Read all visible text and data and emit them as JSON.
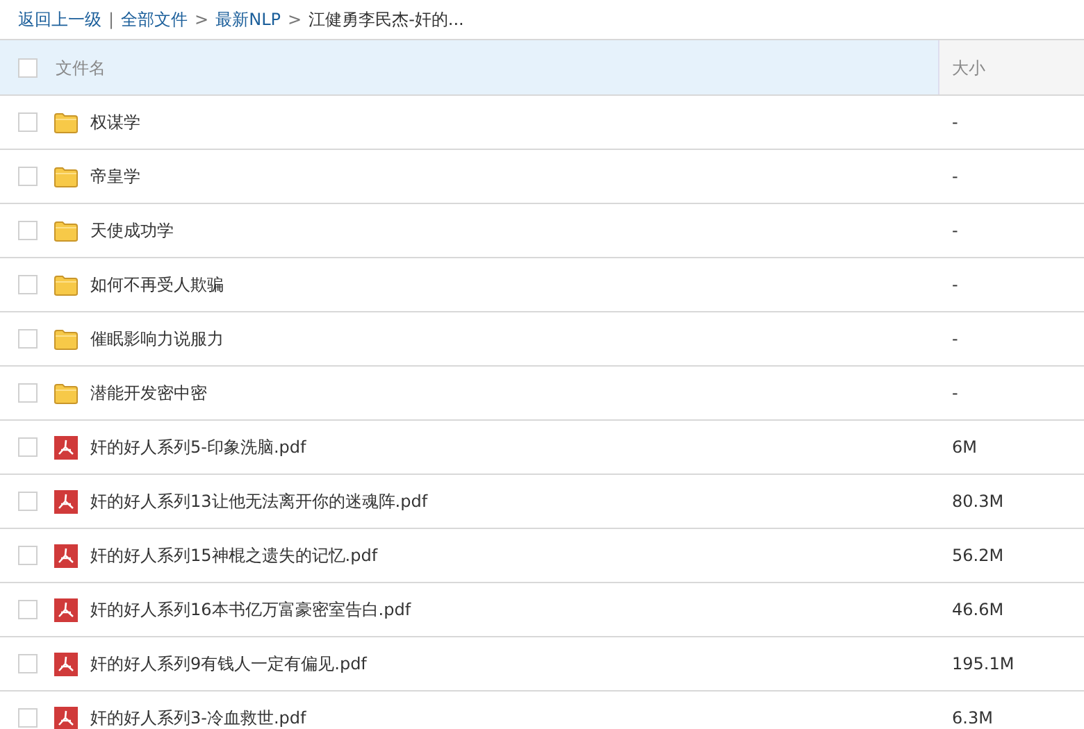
{
  "breadcrumb": {
    "back": "返回上一级",
    "separator": "|",
    "links": [
      "全部文件",
      "最新NLP"
    ],
    "arrow": ">",
    "current": "江健勇李民杰-奸的..."
  },
  "table": {
    "select_all": {
      "checked": false
    },
    "columns": [
      "文件名",
      "大小"
    ],
    "rows": [
      {
        "kind": "folder",
        "name": "权谋学",
        "size": "-",
        "checked": false
      },
      {
        "kind": "folder",
        "name": "帝皇学",
        "size": "-",
        "checked": false
      },
      {
        "kind": "folder",
        "name": "天使成功学",
        "size": "-",
        "checked": false
      },
      {
        "kind": "folder",
        "name": "如何不再受人欺骗",
        "size": "-",
        "checked": false
      },
      {
        "kind": "folder",
        "name": "催眠影响力说服力",
        "size": "-",
        "checked": false
      },
      {
        "kind": "folder",
        "name": "潜能开发密中密",
        "size": "-",
        "checked": false
      },
      {
        "kind": "pdf",
        "name": "奸的好人系列5-印象洗脑.pdf",
        "size": "6M",
        "checked": false
      },
      {
        "kind": "pdf",
        "name": "奸的好人系列13让他无法离开你的迷魂阵.pdf",
        "size": "80.3M",
        "checked": false
      },
      {
        "kind": "pdf",
        "name": "奸的好人系列15神棍之遗失的记忆.pdf",
        "size": "56.2M",
        "checked": false
      },
      {
        "kind": "pdf",
        "name": "奸的好人系列16本书亿万富豪密室告白.pdf",
        "size": "46.6M",
        "checked": false
      },
      {
        "kind": "pdf",
        "name": "奸的好人系列9有钱人一定有偏见.pdf",
        "size": "195.1M",
        "checked": false
      },
      {
        "kind": "pdf",
        "name": "奸的好人系列3-冷血救世.pdf",
        "size": "6.3M",
        "checked": false
      }
    ]
  }
}
